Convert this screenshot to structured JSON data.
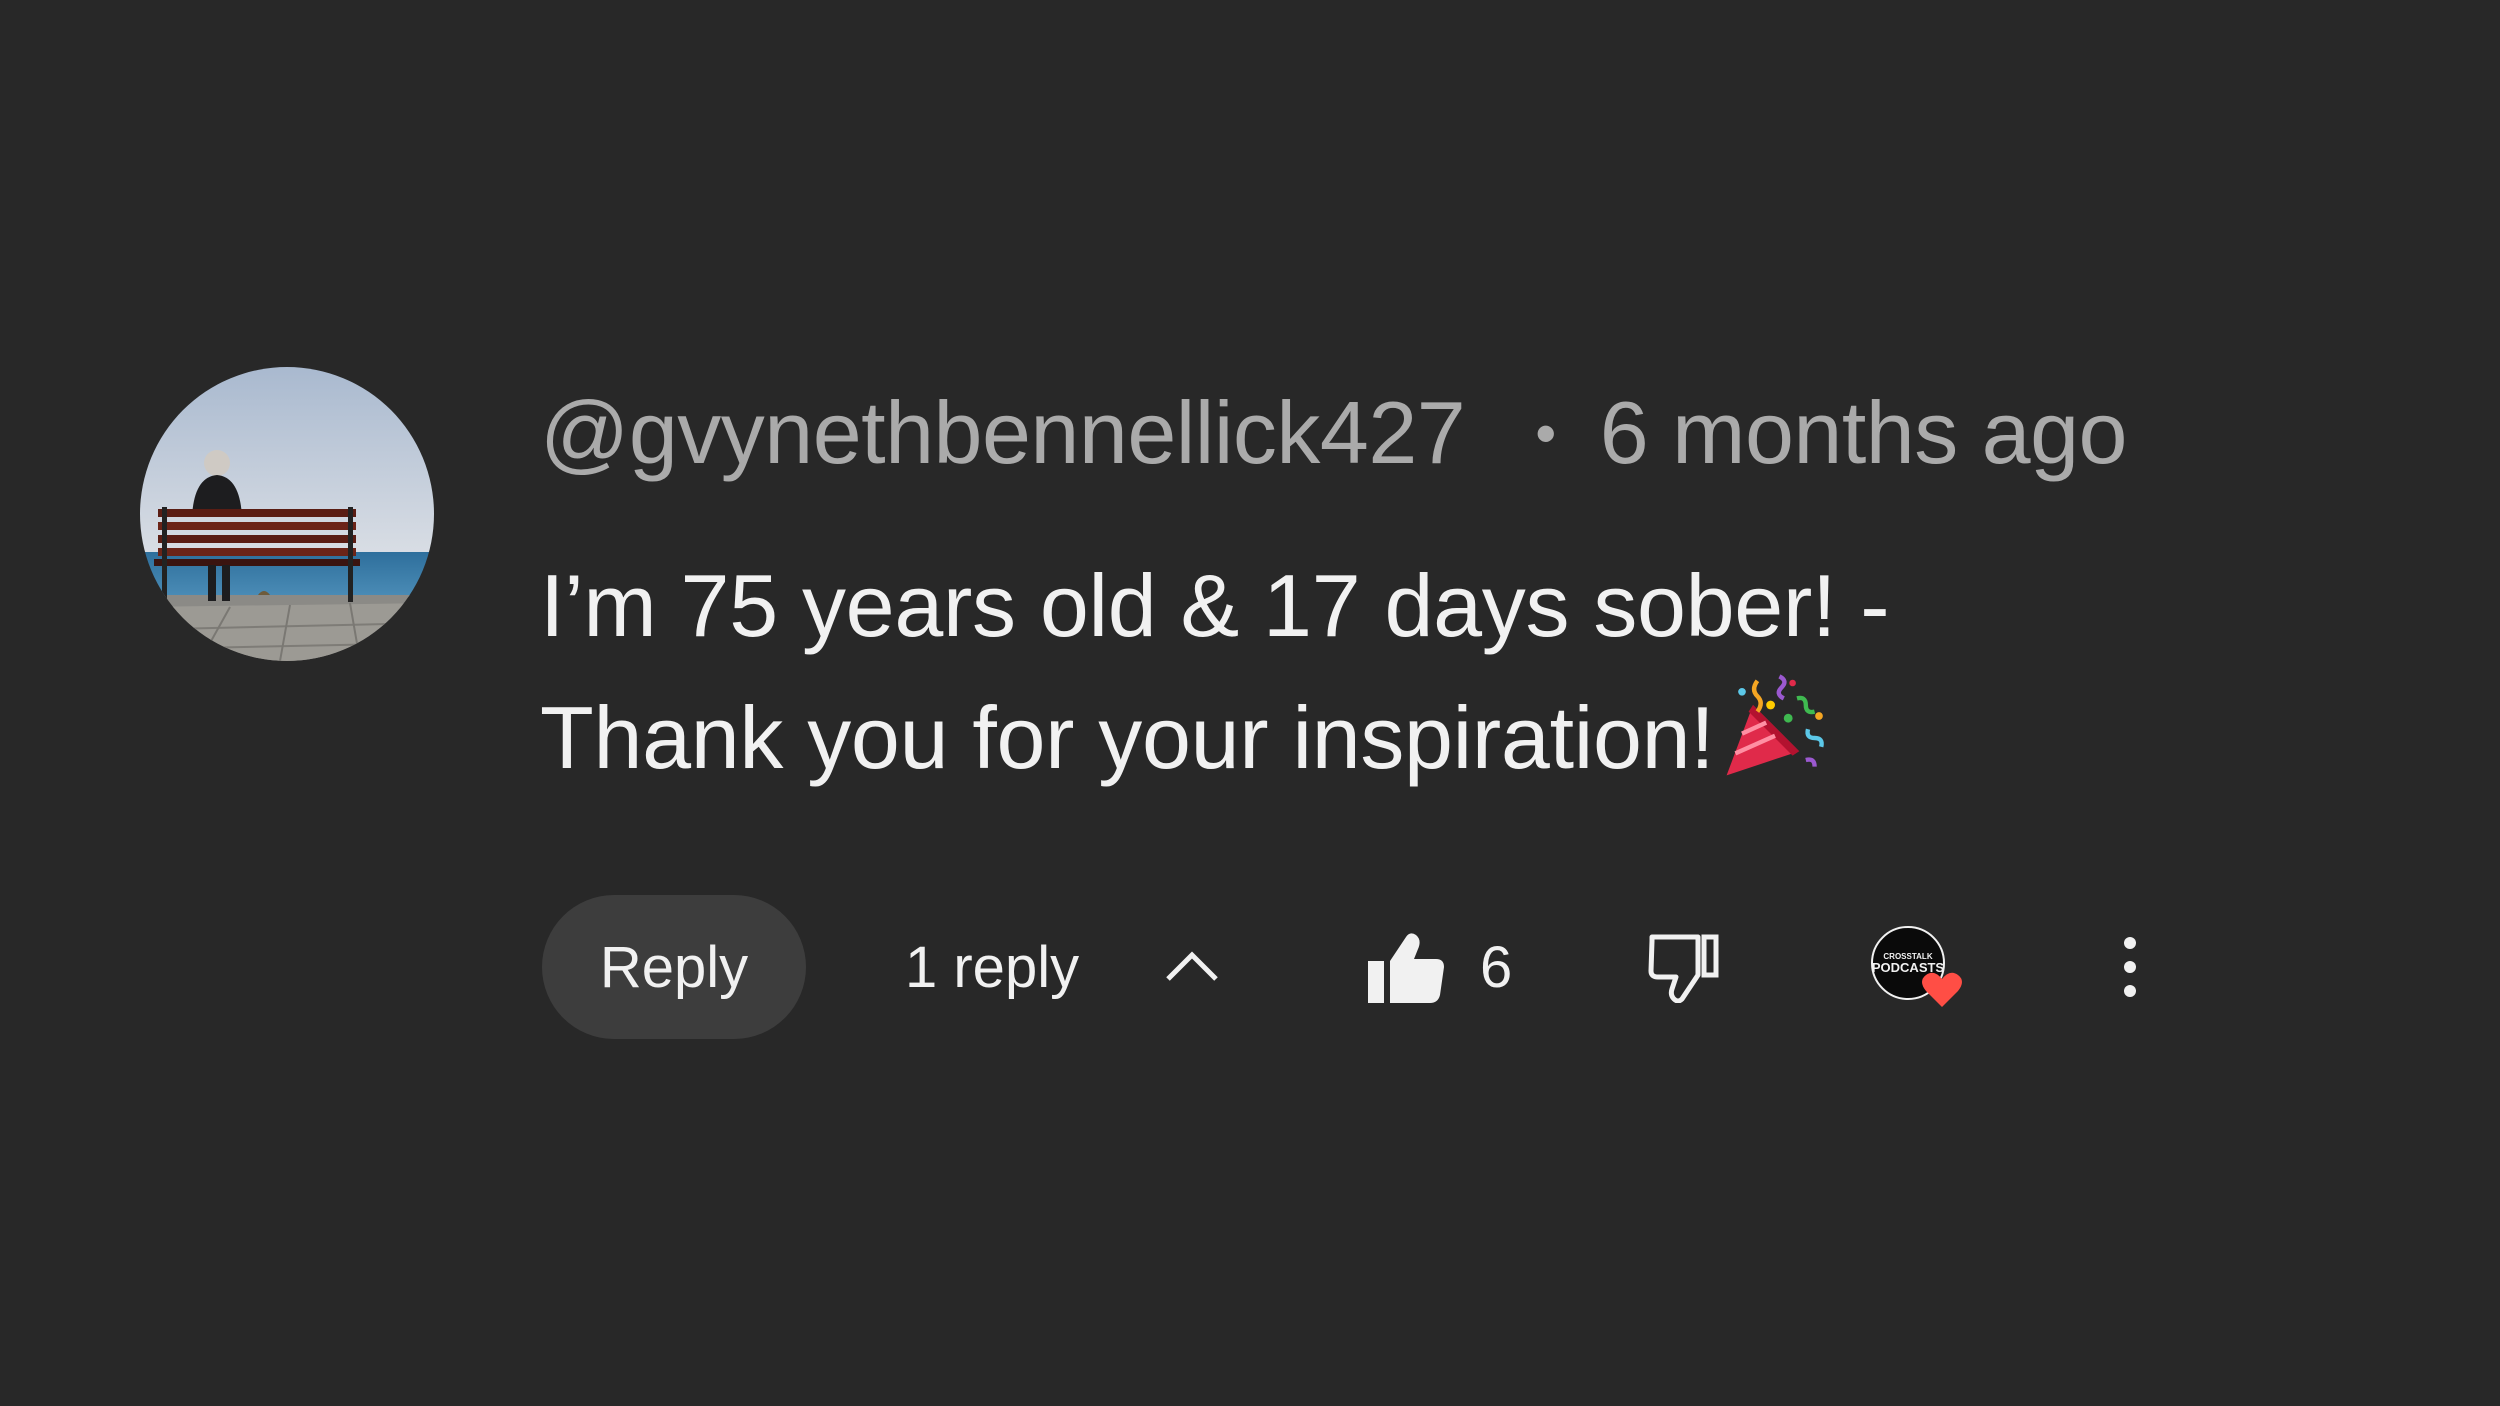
{
  "comment": {
    "author": "@gvynethbennellick427",
    "separator": "•",
    "timestamp": "6 months ago",
    "text_line1": "I’m 75 years old & 17 days sober! -",
    "text_line2": "Thank you for your inspiration!",
    "emoji": "party-popper"
  },
  "actions": {
    "reply_label": "Reply",
    "reply_count": "1 reply",
    "like_count": "6",
    "creator_badge_text_top": "CROSSTALK",
    "creator_badge_text_bottom": "PODCASTS"
  },
  "icons": {
    "avatar": "avatar-man-on-bench",
    "collapse": "chevron-up-icon",
    "like": "thumbs-up-filled-icon",
    "dislike": "thumbs-down-outline-icon",
    "creator_heart": "heart-icon",
    "more": "more-vertical-icon"
  },
  "colors": {
    "background": "#282828",
    "primary_text": "#f1f1f1",
    "secondary_text": "#aaaaaa",
    "button_bg": "#3d3d3d",
    "heart": "#ff4e45"
  }
}
